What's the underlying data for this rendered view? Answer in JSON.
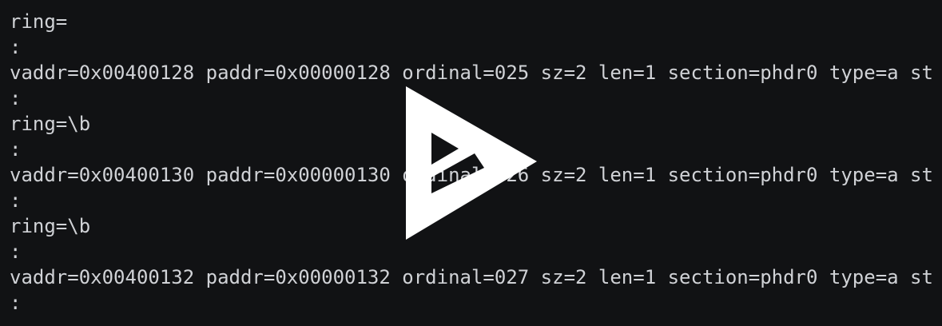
{
  "terminal": {
    "lines": [
      "ring=",
      ":",
      "vaddr=0x00400128 paddr=0x00000128 ordinal=025 sz=2 len=1 section=phdr0 type=a st",
      ":",
      "ring=\\b",
      ":",
      "vaddr=0x00400130 paddr=0x00000130 ordinal=026 sz=2 len=1 section=phdr0 type=a st",
      ":",
      "ring=\\b",
      ":",
      "vaddr=0x00400132 paddr=0x00000132 ordinal=027 sz=2 len=1 section=phdr0 type=a st",
      ":"
    ]
  },
  "overlay": {
    "icon": "asciinema-play-logo-icon",
    "color": "#ffffff"
  },
  "colors": {
    "background": "#111214",
    "text": "#d0d2d6"
  }
}
